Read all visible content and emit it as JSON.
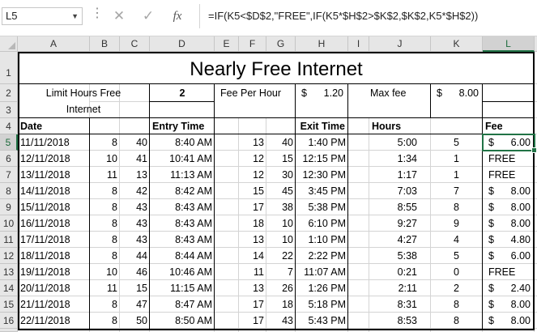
{
  "name_box": "L5",
  "formula_bar": {
    "cancel_glyph": "✕",
    "enter_glyph": "✓",
    "fx_label": "fx",
    "formula": "=IF(K5<$D$2,\"FREE\",IF(K5*$H$2>$K$2,$K$2,K5*$H$2))"
  },
  "columns": [
    "A",
    "B",
    "C",
    "D",
    "E",
    "F",
    "G",
    "H",
    "I",
    "J",
    "K",
    "L"
  ],
  "selected_column": "L",
  "rows": [
    "1",
    "2",
    "3",
    "4",
    "5",
    "6",
    "7",
    "8",
    "9",
    "10",
    "11",
    "12",
    "13",
    "14",
    "15",
    "16"
  ],
  "selected_row": "5",
  "sheet": {
    "title": "Nearly Free Internet",
    "limit_label_1": "Limit Hours Free",
    "limit_label_2": "Internet",
    "limit_value": "2",
    "fee_label": "Fee Per Hour",
    "fee_currency": "$",
    "fee_value": "1.20",
    "max_label": "Max fee",
    "max_currency": "$",
    "max_value": "8.00",
    "headers": {
      "date": "Date",
      "entry": "Entry Time",
      "exit": "Exit Time",
      "hours": "Hours",
      "fee": "Fee"
    },
    "data": [
      [
        "11/11/2018",
        "8",
        "40",
        "8:40 AM",
        "13",
        "40",
        "1:40 PM",
        "5:00",
        "5",
        "$",
        "6.00"
      ],
      [
        "12/11/2018",
        "10",
        "41",
        "10:41 AM",
        "12",
        "15",
        "12:15 PM",
        "1:34",
        "1",
        "",
        "FREE"
      ],
      [
        "13/11/2018",
        "11",
        "13",
        "11:13 AM",
        "12",
        "30",
        "12:30 PM",
        "1:17",
        "1",
        "",
        "FREE"
      ],
      [
        "14/11/2018",
        "8",
        "42",
        "8:42 AM",
        "15",
        "45",
        "3:45 PM",
        "7:03",
        "7",
        "$",
        "8.00"
      ],
      [
        "15/11/2018",
        "8",
        "43",
        "8:43 AM",
        "17",
        "38",
        "5:38 PM",
        "8:55",
        "8",
        "$",
        "8.00"
      ],
      [
        "16/11/2018",
        "8",
        "43",
        "8:43 AM",
        "18",
        "10",
        "6:10 PM",
        "9:27",
        "9",
        "$",
        "8.00"
      ],
      [
        "17/11/2018",
        "8",
        "43",
        "8:43 AM",
        "13",
        "10",
        "1:10 PM",
        "4:27",
        "4",
        "$",
        "4.80"
      ],
      [
        "18/11/2018",
        "8",
        "44",
        "8:44 AM",
        "14",
        "22",
        "2:22 PM",
        "5:38",
        "5",
        "$",
        "6.00"
      ],
      [
        "19/11/2018",
        "10",
        "46",
        "10:46 AM",
        "11",
        "7",
        "11:07 AM",
        "0:21",
        "0",
        "",
        "FREE"
      ],
      [
        "20/11/2018",
        "11",
        "15",
        "11:15 AM",
        "13",
        "26",
        "1:26 PM",
        "2:11",
        "2",
        "$",
        "2.40"
      ],
      [
        "21/11/2018",
        "8",
        "47",
        "8:47 AM",
        "17",
        "18",
        "5:18 PM",
        "8:31",
        "8",
        "$",
        "8.00"
      ],
      [
        "22/11/2018",
        "8",
        "50",
        "8:50 AM",
        "17",
        "43",
        "5:43 PM",
        "8:53",
        "8",
        "$",
        "8.00"
      ]
    ]
  },
  "colors": {
    "selection": "#217346",
    "header_bg": "#e6e6e6",
    "gridline": "#d4d4d4"
  }
}
